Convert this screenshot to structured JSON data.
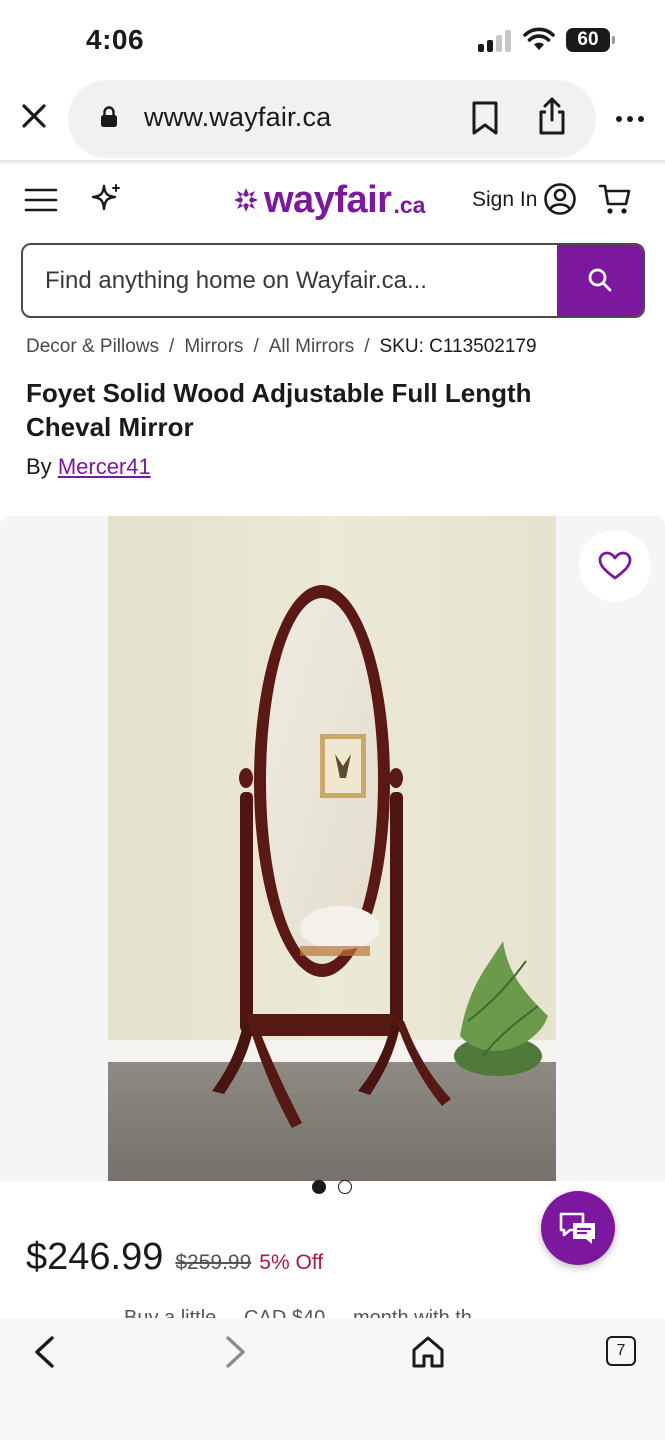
{
  "status_bar": {
    "time": "4:06",
    "battery": "60"
  },
  "browser": {
    "url": "www.wayfair.ca",
    "tab_count": "7"
  },
  "site": {
    "logo_word": "wayfair",
    "logo_tld": ".ca",
    "sign_in": "Sign In",
    "search_placeholder": "Find anything home on Wayfair.ca..."
  },
  "breadcrumb": [
    "Decor & Pillows",
    "Mirrors",
    "All Mirrors",
    "SKU: C113502179"
  ],
  "product": {
    "title": "Foyet Solid Wood Adjustable Full Length Cheval Mirror",
    "by_prefix": "By",
    "brand": "Mercer41",
    "price": "$246.99",
    "original_price": "$259.99",
    "discount": "5% Off",
    "finance_peek": "Buy a little ... CAD $40 ... month with th..."
  },
  "gallery": {
    "image_count": 2,
    "active_index": 0
  },
  "colors": {
    "brand_purple": "#7b189f",
    "discount_red": "#b0173b"
  },
  "icons": [
    "close-icon",
    "lock-icon",
    "bookmark-icon",
    "share-icon",
    "more-icon",
    "menu-icon",
    "sparkle-icon",
    "account-icon",
    "cart-icon",
    "search-icon",
    "heart-icon",
    "chat-icon",
    "back-icon",
    "forward-icon",
    "home-icon",
    "tabs-icon"
  ]
}
